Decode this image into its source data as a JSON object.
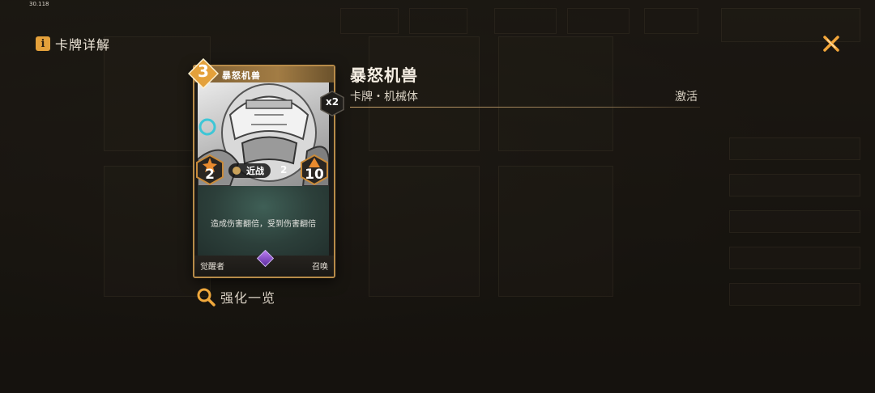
{
  "fps_readout": "30.118",
  "header": {
    "title": "卡牌详解",
    "info_icon": "i"
  },
  "card": {
    "cost": "3",
    "name": "暴怒机兽",
    "count": "x2",
    "attack": "2",
    "health": "10",
    "keyword": "近战",
    "attack_times": "2",
    "description": "造成伤害翻倍，受到伤害翻倍",
    "faction": "觉醒者",
    "card_kind": "召唤"
  },
  "detail": {
    "name": "暴怒机兽",
    "subtitle": "卡牌・机械体",
    "status": "激活"
  },
  "enhance": {
    "label": "强化一览"
  },
  "colors": {
    "accent": "#e4a13b",
    "card_frame": "#b78b49",
    "text": "#eee6d8"
  }
}
